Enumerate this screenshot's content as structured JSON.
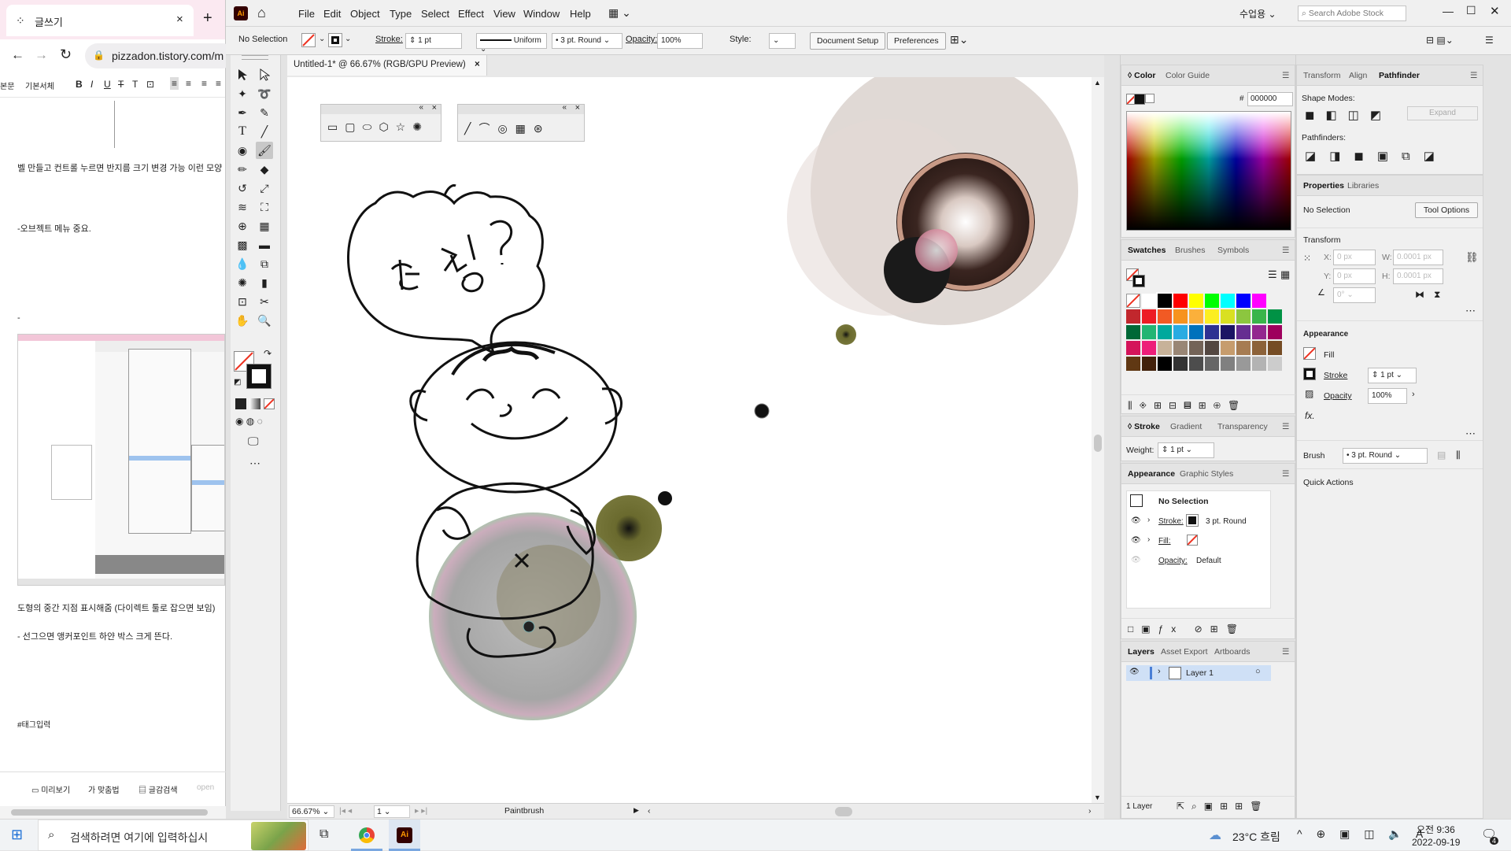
{
  "browser": {
    "tab_title": "글쓰기",
    "url": "pizzadon.tistory.com/m",
    "font_select": "본문",
    "font_name": "기본서체",
    "lines": [
      "벨 만들고 컨트롤 누르면 반지름 크기 변경 가능 이런 모양",
      "-오브젝트 메뉴 중요.",
      "도형의 중간 지점 표시해줌 (다이렉트 툴로 잡으면 보임)",
      "- 선그으면 앵커포인트 하얀 박스 크게 뜬다.",
      "#태그입력"
    ],
    "bottom": {
      "preview": "미리보기",
      "spell": "맞춤법",
      "save": "글감검색",
      "open": "open"
    }
  },
  "ai": {
    "logo": "Ai",
    "menus": [
      "File",
      "Edit",
      "Object",
      "Type",
      "Select",
      "Effect",
      "View",
      "Window",
      "Help"
    ],
    "user": "수업용",
    "search_placeholder": "Search Adobe Stock",
    "control": {
      "selection": "No Selection",
      "stroke_label": "Stroke:",
      "stroke_weight": "1 pt",
      "profile": "Uniform",
      "brush": "3 pt. Round",
      "opacity_label": "Opacity:",
      "opacity": "100%",
      "style_label": "Style:",
      "doc_setup": "Document Setup",
      "preferences": "Preferences"
    },
    "doc_tab": "Untitled-1* @ 66.67% (RGB/GPU Preview)",
    "status": {
      "zoom": "66.67%",
      "artboard": "1",
      "tool": "Paintbrush"
    },
    "color_panel": {
      "tabs": [
        "Color",
        "Color Guide"
      ],
      "hex": "000000"
    },
    "swatches_panel": {
      "tabs": [
        "Swatches",
        "Brushes",
        "Symbols"
      ]
    },
    "stroke_panel": {
      "tabs": [
        "Stroke",
        "Gradient",
        "Transparency"
      ],
      "weight_label": "Weight:",
      "weight": "1 pt"
    },
    "appearance_panel": {
      "tabs": [
        "Appearance",
        "Graphic Styles"
      ],
      "title": "No Selection",
      "rows": [
        {
          "label": "Stroke:",
          "value": "3 pt. Round"
        },
        {
          "label": "Fill:",
          "value": ""
        },
        {
          "label": "Opacity:",
          "value": "Default"
        }
      ]
    },
    "layers_panel": {
      "tabs": [
        "Layers",
        "Asset Export",
        "Artboards"
      ],
      "layer": "Layer 1",
      "count": "1 Layer"
    },
    "right_panel": {
      "tabs": [
        "Transform",
        "Align",
        "Pathfinder"
      ],
      "shape_modes": "Shape Modes:",
      "expand": "Expand",
      "pathfinders": "Pathfinders:",
      "tabs2": [
        "Properties",
        "Libraries"
      ],
      "no_selection": "No Selection",
      "tool_options": "Tool Options",
      "transform": "Transform",
      "x_label": "X:",
      "x_val": "0 px",
      "y_label": "Y:",
      "y_val": "0 px",
      "w_label": "W:",
      "w_val": "0.0001 px",
      "h_label": "H:",
      "h_val": "0.0001 px",
      "angle": "0°",
      "appearance": "Appearance",
      "fill": "Fill",
      "stroke": "Stroke",
      "stroke_val": "1 pt",
      "opacity": "Opacity",
      "opacity_val": "100%",
      "brush": "Brush",
      "brush_val": "3 pt. Round",
      "quick_actions": "Quick Actions"
    }
  },
  "taskbar": {
    "search_placeholder": "검색하려면 여기에 입력하십시",
    "weather": "23°C 흐림",
    "time": "오전 9:36",
    "date": "2022-09-19",
    "notif": "4"
  },
  "colors": {
    "accent": "#cfe0f6",
    "ai_orange": "#ff9a00",
    "ai_dark": "#330000"
  }
}
